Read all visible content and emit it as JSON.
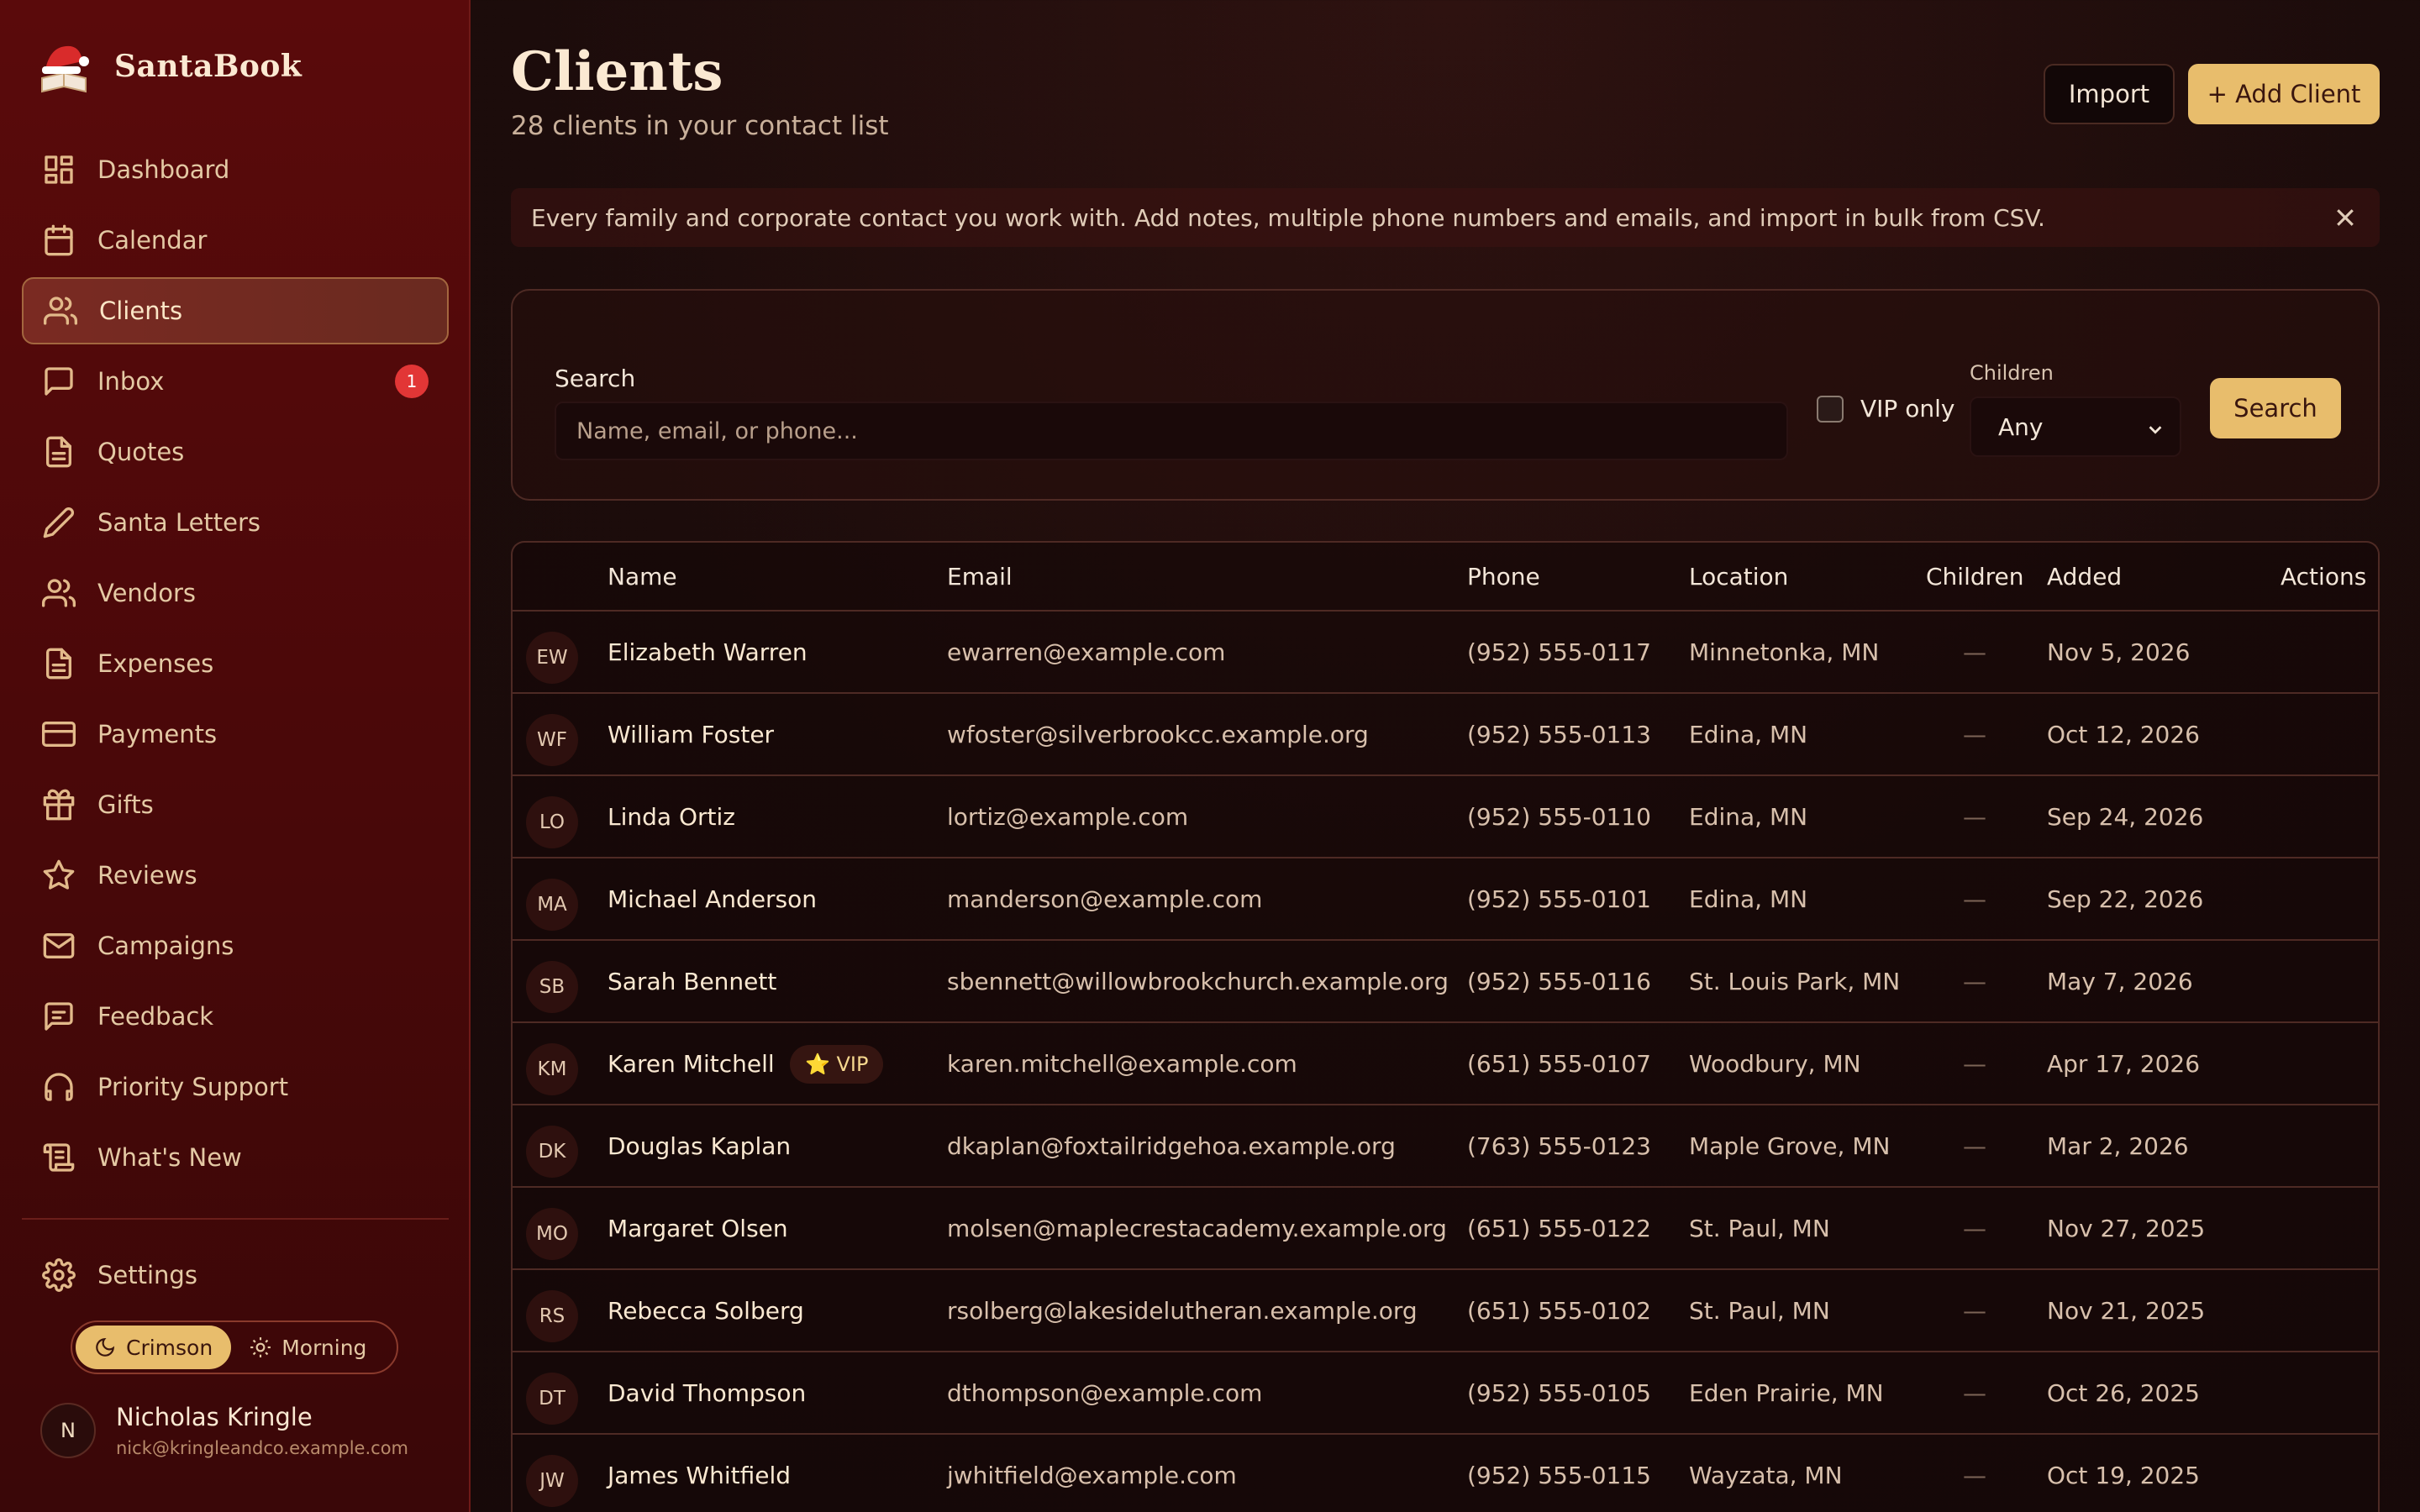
{
  "app": {
    "name": "SantaBook"
  },
  "sidebar": {
    "items": [
      {
        "label": "Dashboard",
        "icon": "dashboard-icon"
      },
      {
        "label": "Calendar",
        "icon": "calendar-icon"
      },
      {
        "label": "Clients",
        "icon": "users-icon",
        "active": true
      },
      {
        "label": "Inbox",
        "icon": "message-icon",
        "badge": "1"
      },
      {
        "label": "Quotes",
        "icon": "document-icon"
      },
      {
        "label": "Santa Letters",
        "icon": "pen-icon"
      },
      {
        "label": "Vendors",
        "icon": "users-icon"
      },
      {
        "label": "Expenses",
        "icon": "document-icon"
      },
      {
        "label": "Payments",
        "icon": "credit-card-icon"
      },
      {
        "label": "Gifts",
        "icon": "gift-icon"
      },
      {
        "label": "Reviews",
        "icon": "star-icon"
      },
      {
        "label": "Campaigns",
        "icon": "mail-icon"
      },
      {
        "label": "Feedback",
        "icon": "feedback-icon"
      },
      {
        "label": "Priority Support",
        "icon": "headphones-icon"
      },
      {
        "label": "What's New",
        "icon": "scroll-icon"
      }
    ],
    "settings_label": "Settings",
    "theme": {
      "crimson": "Crimson",
      "morning": "Morning"
    },
    "user": {
      "initial": "N",
      "name": "Nicholas Kringle",
      "email": "nick@kringleandco.example.com"
    }
  },
  "header": {
    "title": "Clients",
    "subtitle": "28 clients in your contact list",
    "import_label": "Import",
    "add_label": "+ Add Client"
  },
  "banner": {
    "text": "Every family and corporate contact you work with. Add notes, multiple phone numbers and emails, and import in bulk from CSV."
  },
  "search": {
    "label": "Search",
    "placeholder": "Name, email, or phone...",
    "vip_label": "VIP only",
    "children_label": "Children",
    "children_value": "Any",
    "button_label": "Search"
  },
  "table": {
    "headers": {
      "name": "Name",
      "email": "Email",
      "phone": "Phone",
      "location": "Location",
      "children": "Children",
      "added": "Added",
      "actions": "Actions"
    },
    "rows": [
      {
        "initials": "EW",
        "name": "Elizabeth Warren",
        "email": "ewarren@example.com",
        "phone": "(952) 555-0117",
        "location": "Minnetonka, MN",
        "children": "—",
        "added": "Nov 5, 2026"
      },
      {
        "initials": "WF",
        "name": "William Foster",
        "email": "wfoster@silverbrookcc.example.org",
        "phone": "(952) 555-0113",
        "location": "Edina, MN",
        "children": "—",
        "added": "Oct 12, 2026"
      },
      {
        "initials": "LO",
        "name": "Linda Ortiz",
        "email": "lortiz@example.com",
        "phone": "(952) 555-0110",
        "location": "Edina, MN",
        "children": "—",
        "added": "Sep 24, 2026"
      },
      {
        "initials": "MA",
        "name": "Michael Anderson",
        "email": "manderson@example.com",
        "phone": "(952) 555-0101",
        "location": "Edina, MN",
        "children": "—",
        "added": "Sep 22, 2026"
      },
      {
        "initials": "SB",
        "name": "Sarah Bennett",
        "email": "sbennett@willowbrookchurch.example.org",
        "phone": "(952) 555-0116",
        "location": "St. Louis Park, MN",
        "children": "—",
        "added": "May 7, 2026"
      },
      {
        "initials": "KM",
        "name": "Karen Mitchell",
        "vip": "⭐ VIP",
        "email": "karen.mitchell@example.com",
        "phone": "(651) 555-0107",
        "location": "Woodbury, MN",
        "children": "—",
        "added": "Apr 17, 2026"
      },
      {
        "initials": "DK",
        "name": "Douglas Kaplan",
        "email": "dkaplan@foxtailridgehoa.example.org",
        "phone": "(763) 555-0123",
        "location": "Maple Grove, MN",
        "children": "—",
        "added": "Mar 2, 2026"
      },
      {
        "initials": "MO",
        "name": "Margaret Olsen",
        "email": "molsen@maplecrestacademy.example.org",
        "phone": "(651) 555-0122",
        "location": "St. Paul, MN",
        "children": "—",
        "added": "Nov 27, 2025"
      },
      {
        "initials": "RS",
        "name": "Rebecca Solberg",
        "email": "rsolberg@lakesidelutheran.example.org",
        "phone": "(651) 555-0102",
        "location": "St. Paul, MN",
        "children": "—",
        "added": "Nov 21, 2025"
      },
      {
        "initials": "DT",
        "name": "David Thompson",
        "email": "dthompson@example.com",
        "phone": "(952) 555-0105",
        "location": "Eden Prairie, MN",
        "children": "—",
        "added": "Oct 26, 2025"
      },
      {
        "initials": "JW",
        "name": "James Whitfield",
        "email": "jwhitfield@example.com",
        "phone": "(952) 555-0115",
        "location": "Wayzata, MN",
        "children": "—",
        "added": "Oct 19, 2025"
      }
    ]
  },
  "colors": {
    "accent": "#e8bd6c",
    "sidebar": "#4a0809",
    "badge": "#e23636"
  }
}
